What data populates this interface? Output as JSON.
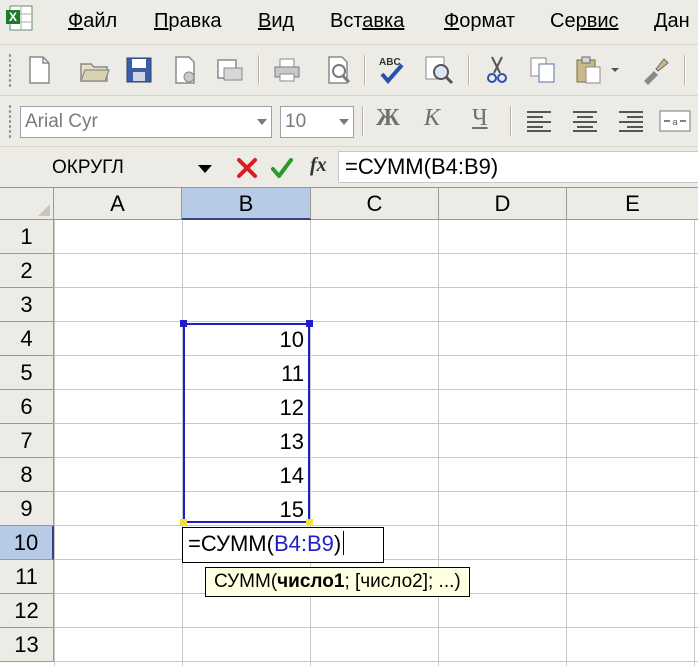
{
  "menu": {
    "items": [
      {
        "label": "Файл",
        "accel": "Ф",
        "rest": "айл"
      },
      {
        "label": "Правка",
        "accel": "П",
        "rest": "равка"
      },
      {
        "label": "Вид",
        "accel": "В",
        "rest": "ид"
      },
      {
        "label": "Вставка",
        "accel": "Вст",
        "rest": "авка"
      },
      {
        "label": "Формат",
        "accel": "Ф",
        "rest": "ормат"
      },
      {
        "label": "Сервис",
        "accel": "Се",
        "rest": "рвис"
      },
      {
        "label": "Дан",
        "accel": "Дан",
        "rest": ""
      }
    ]
  },
  "toolbar_format": {
    "font_name": "Arial Cyr",
    "font_size": "10",
    "bold_label": "Ж",
    "italic_label": "К",
    "underline_label": "Ч"
  },
  "formula_bar": {
    "name_box": "ОКРУГЛ",
    "fx_label": "fx",
    "formula": "=СУММ(B4:B9)"
  },
  "grid": {
    "columns": [
      "A",
      "B",
      "C",
      "D",
      "E"
    ],
    "active_column": "B",
    "rows": [
      "1",
      "2",
      "3",
      "4",
      "5",
      "6",
      "7",
      "8",
      "9",
      "10",
      "11",
      "12",
      "13"
    ],
    "active_row": "10",
    "values_b": [
      "10",
      "11",
      "12",
      "13",
      "14",
      "15"
    ]
  },
  "edit_cell": {
    "prefix": "=СУММ(",
    "ref": "B4:B9",
    "suffix": ")"
  },
  "tooltip": {
    "func": "СУММ(",
    "arg1": "число1",
    "rest": "; [число2]; ...)"
  },
  "colors": {
    "accent_blue": "#1f1fc7",
    "header_active": "#b7cbe7",
    "cancel_red": "#d81e1e",
    "enter_green": "#2a9a2a"
  }
}
